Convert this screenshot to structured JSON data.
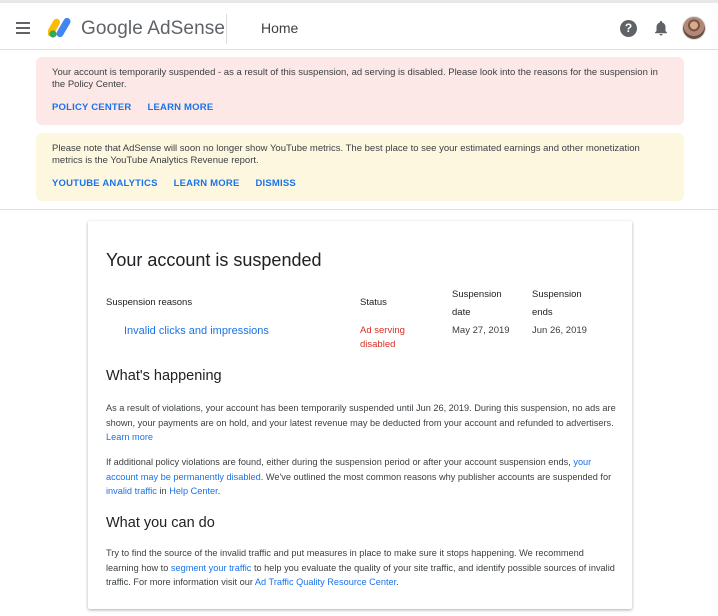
{
  "header": {
    "brand_google": "Google",
    "brand_product": "AdSense",
    "page_title": "Home",
    "help_glyph": "?"
  },
  "banners": {
    "suspension": {
      "message": "Your account is temporarily suspended - as a result of this suspension, ad serving is disabled. Please look into the reasons for the suspension in the Policy Center.",
      "actions": [
        "POLICY CENTER",
        "LEARN MORE"
      ],
      "color": "#fce8e6"
    },
    "youtube": {
      "message": "Please note that AdSense will soon no longer show YouTube metrics. The best place to see your estimated earnings and other monetization metrics is the YouTube Analytics Revenue report.",
      "actions": [
        "YOUTUBE ANALYTICS",
        "LEARN MORE",
        "DISMISS"
      ],
      "color": "#fef7e0"
    }
  },
  "card": {
    "title": "Your account is suspended",
    "table": {
      "headers": {
        "reasons": "Suspension reasons",
        "status": "Status",
        "date_line1": "Suspension",
        "date_line2": "date",
        "ends_line1": "Suspension",
        "ends_line2": "ends"
      },
      "row": {
        "reason": "Invalid clicks and impressions",
        "status_line1": "Ad serving",
        "status_line2": "disabled",
        "date": "May 27, 2019",
        "ends": "Jun 26, 2019"
      }
    },
    "happening": {
      "heading": "What's happening",
      "p1_text": "As a result of violations, your account has been temporarily suspended until Jun 26, 2019. During this suspension, no ads are shown, your payments are on hold, and your latest revenue may be deducted from your account and refunded to advertisers.",
      "p1_link": "Learn more",
      "p2_a": "If additional policy violations are found, either during the suspension period or after your account suspension ends,",
      "p2_link1": "your account may be permanently disabled",
      "p2_b": ". We've outlined the most common reasons why publisher accounts are suspended for",
      "p2_link2": "invalid traffic",
      "p2_c": "in",
      "p2_link3": "Help Center",
      "p2_d": "."
    },
    "can_do": {
      "heading": "What you can do",
      "p_a": "Try to find the source of the invalid traffic and put measures in place to make sure it stops happening. We recommend learning how to",
      "p_link1": "segment your traffic",
      "p_b": "to help you evaluate the quality of your site traffic, and identify possible sources of invalid traffic. For more information visit our",
      "p_link2": "Ad Traffic Quality Resource Center",
      "p_c": "."
    }
  },
  "colors": {
    "accent": "#1a73e8",
    "error": "#d93025"
  },
  "icons": [
    "menu-icon",
    "adsense-logo-icon",
    "help-icon",
    "bell-icon",
    "avatar"
  ]
}
